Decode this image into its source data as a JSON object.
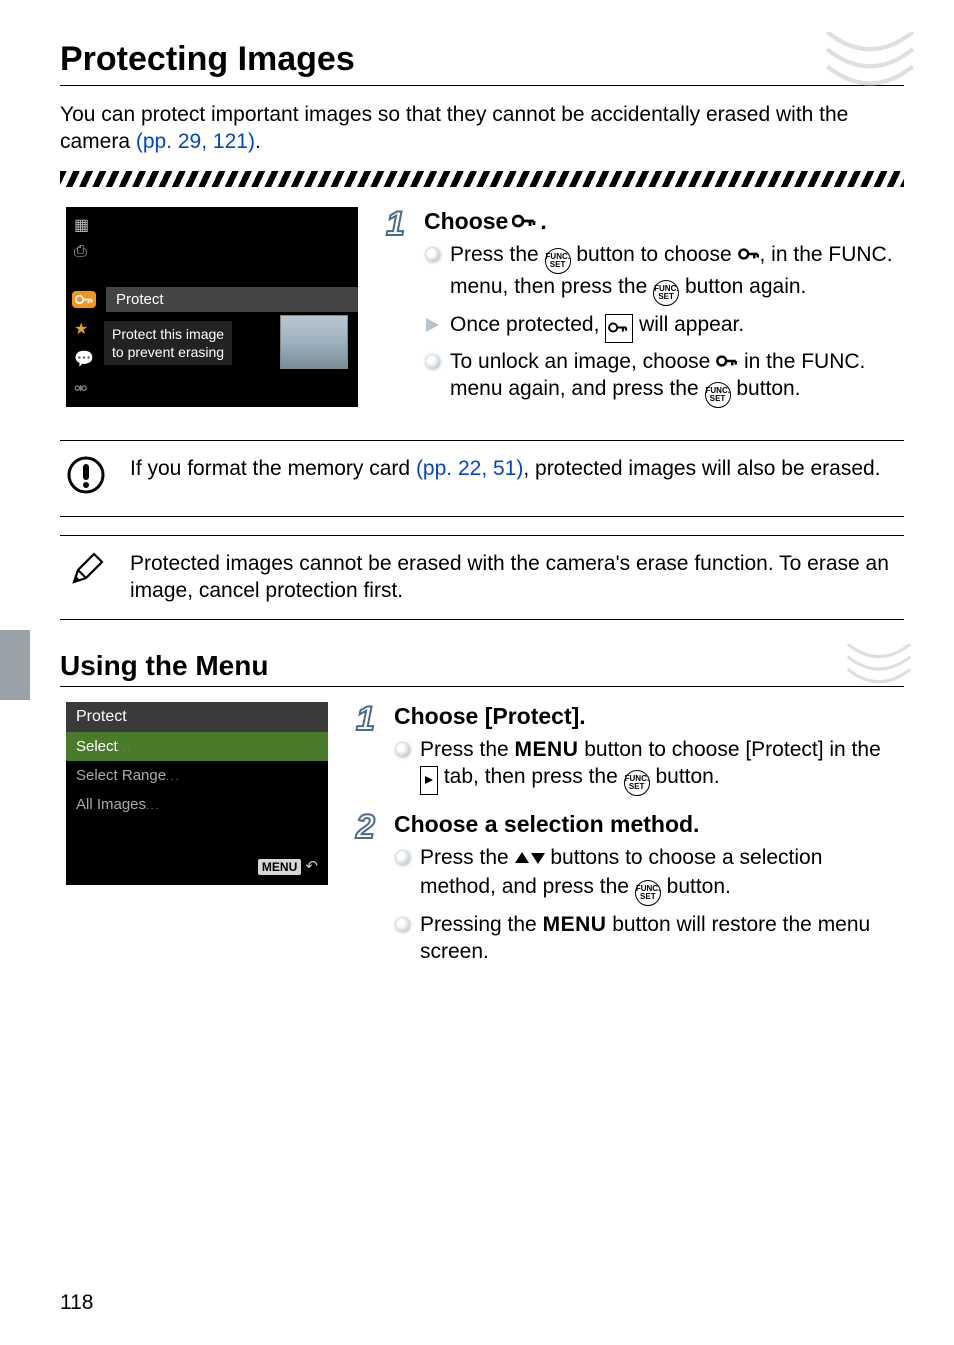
{
  "page_number": "118",
  "title": "Protecting Images",
  "intro_prefix": "You can protect important images so that they cannot be accidentally erased with the camera ",
  "intro_link": "(pp. 29, 121)",
  "intro_suffix": ".",
  "shot1": {
    "label": "Protect",
    "desc_line1": "Protect this image",
    "desc_line2": "to prevent erasing"
  },
  "step1": {
    "title_prefix": "Choose ",
    "title_suffix": ".",
    "b1_a": "Press the ",
    "b1_b": " button to choose ",
    "b1_c": ", in the FUNC. menu, then press the ",
    "b1_d": " button again.",
    "b2_a": "Once protected, ",
    "b2_b": " will appear.",
    "b3_a": "To unlock an image, choose ",
    "b3_b": " in the FUNC. menu again, and press the ",
    "b3_c": " button."
  },
  "callout1_a": "If you format the memory card ",
  "callout1_link": "(pp. 22, 51)",
  "callout1_b": ", protected images will also be erased.",
  "callout2": "Protected images cannot be erased with the camera's erase function. To erase an image, cancel protection first.",
  "subhead": "Using the Menu",
  "shot2": {
    "hdr": "Protect",
    "i1": "Select",
    "i2": "Select Range",
    "i3": "All Images",
    "menu": "MENU"
  },
  "step2": {
    "title": "Choose [Protect].",
    "b1_a": "Press the ",
    "b1_menu": "MENU",
    "b1_b": " button to choose [Protect] in the ",
    "b1_c": " tab, then press the ",
    "b1_d": " button."
  },
  "step3": {
    "title": "Choose a selection method.",
    "b1_a": "Press the ",
    "b1_b": " buttons to choose a selection method, and press the ",
    "b1_c": " button.",
    "b2_a": "Pressing the ",
    "b2_menu": "MENU",
    "b2_b": " button will restore the menu screen."
  },
  "func_set_text": "FUNC.\nSET"
}
